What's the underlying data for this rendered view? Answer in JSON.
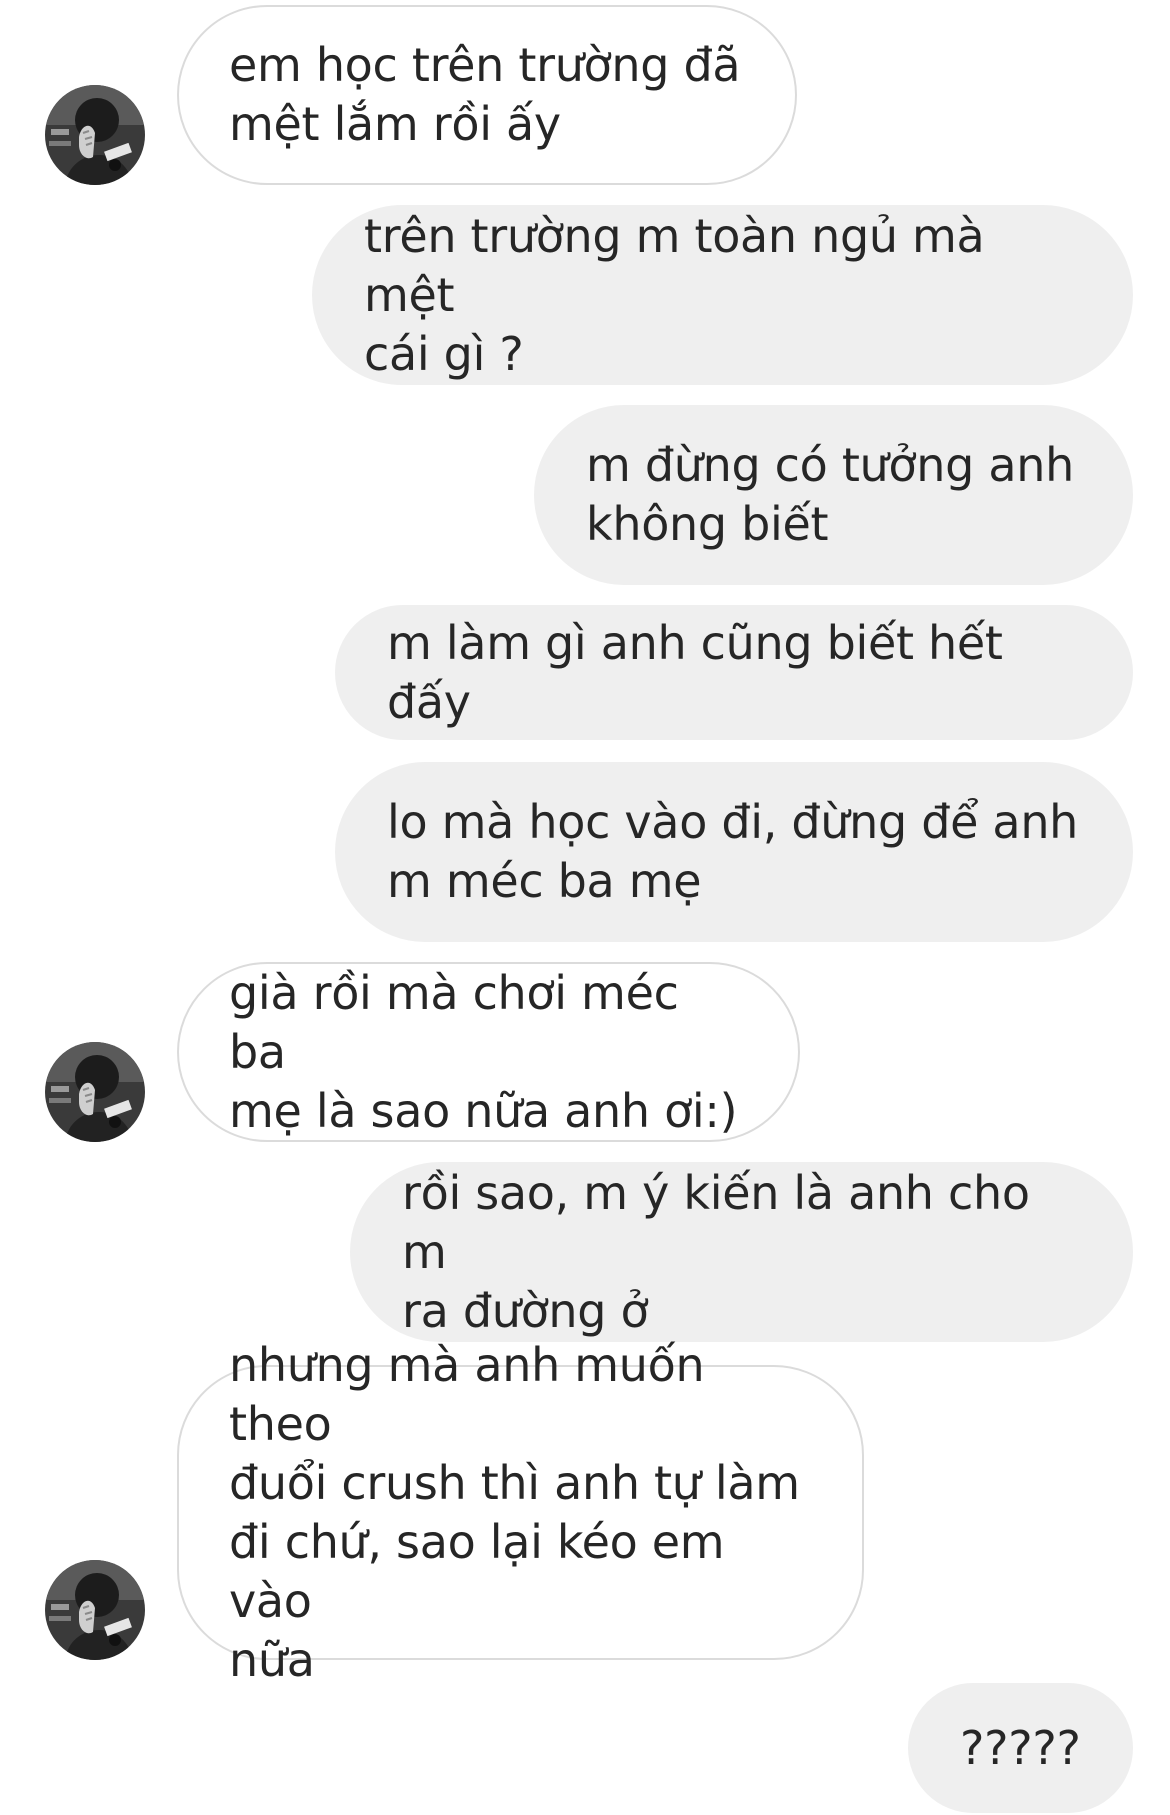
{
  "conversation": {
    "messages": [
      {
        "from": "them",
        "text": "em học trên trường đã\nmệt lắm rồi ấy"
      },
      {
        "from": "me",
        "text": "trên trường m toàn ngủ mà mệt\ncái gì ?"
      },
      {
        "from": "me",
        "text": "m đừng có tưởng anh\nkhông biết"
      },
      {
        "from": "me",
        "text": "m làm gì anh cũng biết hết đấy"
      },
      {
        "from": "me",
        "text": "lo mà học vào đi, đừng để anh\nm méc ba mẹ"
      },
      {
        "from": "them",
        "text": "già rồi mà chơi méc ba\nmẹ là sao nữa anh ơi:)"
      },
      {
        "from": "me",
        "text": "rồi sao, m ý kiến là anh cho m\nra đường ở"
      },
      {
        "from": "them",
        "text": "nhưng mà anh muốn theo\nđuổi crush thì anh tự làm\nđi chứ, sao lại kéo em vào\nnữa"
      },
      {
        "from": "me",
        "text": "?????"
      }
    ]
  },
  "colors": {
    "incoming_bg": "#ffffff",
    "incoming_border": "#dbdbdb",
    "outgoing_bg": "#efefef",
    "text": "#262626"
  },
  "icons": {
    "avatar": "profile-photo-avatar"
  }
}
